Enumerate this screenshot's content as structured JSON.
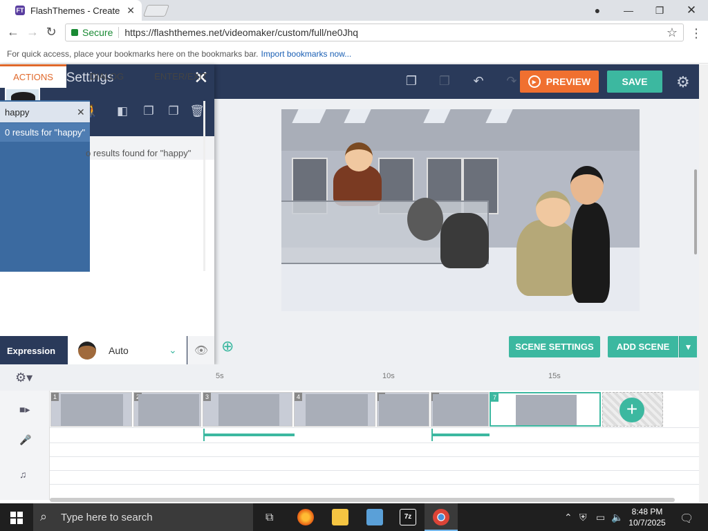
{
  "browser": {
    "tab_title": "FlashThemes - Create",
    "tab_favicon": "FT",
    "secure_label": "Secure",
    "url": "https://flashthemes.net/videomaker/custom/full/ne0Jhq",
    "bookmarks_hint": "For quick access, place your bookmarks here on the bookmarks bar.",
    "bookmarks_link": "Import bookmarks now..."
  },
  "toolbar": {
    "preview_label": "PREVIEW",
    "save_label": "SAVE",
    "accent_orange": "#f07030",
    "accent_teal": "#3cb8a0"
  },
  "character_settings": {
    "title": "Character Settings",
    "tabs": [
      {
        "label": "ACTIONS",
        "active": true
      },
      {
        "label": "DIALOG",
        "active": false
      },
      {
        "label": "ENTER/EXIT",
        "active": false
      }
    ],
    "search": {
      "value": "happy"
    },
    "results_label": "0 results for \"happy\"",
    "no_results_text": "o results found for \"happy\"",
    "expression_label": "Expression",
    "expression_value": "Auto"
  },
  "stage_actions": {
    "scene_settings": "SCENE SETTINGS",
    "add_scene": "ADD SCENE"
  },
  "timeline": {
    "ticks": [
      "5s",
      "10s",
      "15s"
    ],
    "scenes": [
      "1",
      "2",
      "3",
      "4",
      "5",
      "6",
      "7"
    ],
    "selected_scene": "7"
  },
  "taskbar": {
    "search_placeholder": "Type here to search",
    "time": "8:48 PM",
    "date": "10/7/2025"
  }
}
